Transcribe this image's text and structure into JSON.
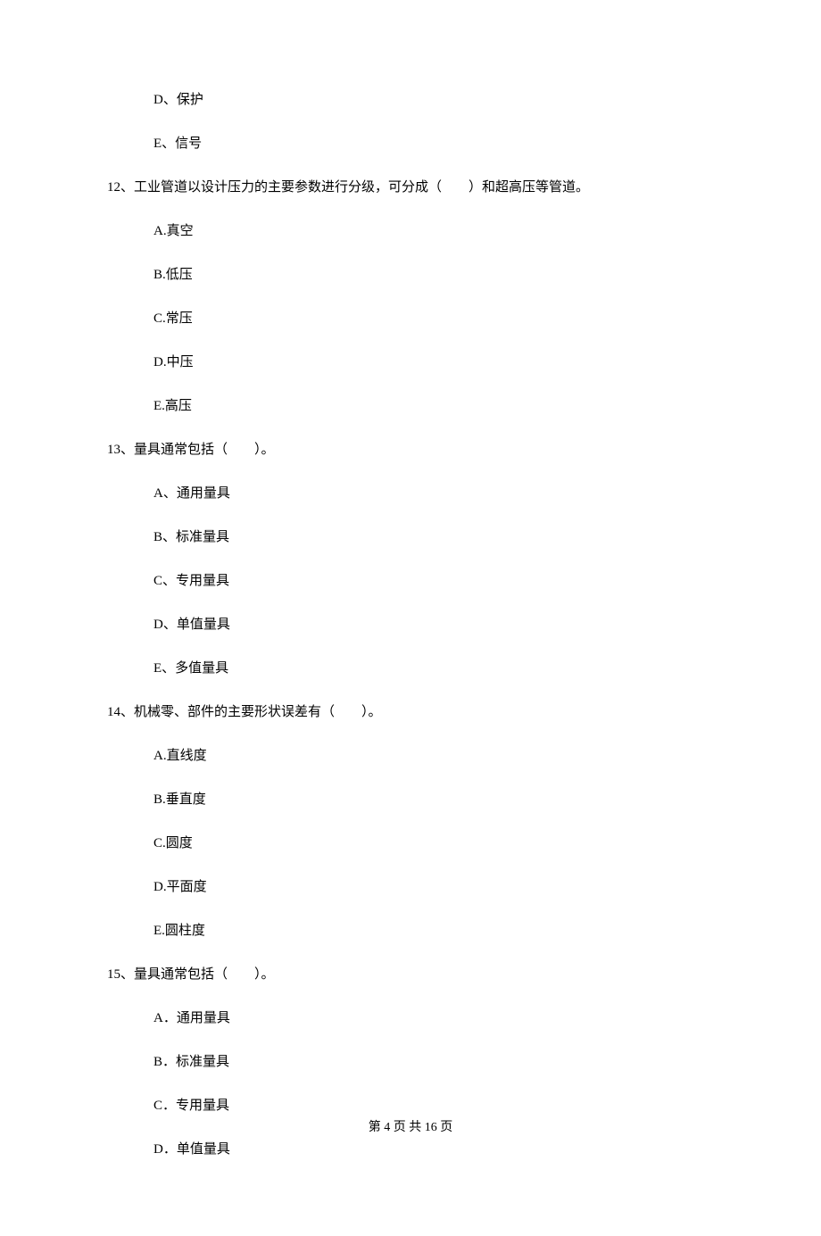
{
  "options_pre": [
    "D、保护",
    "E、信号"
  ],
  "q12": {
    "text": "12、工业管道以设计压力的主要参数进行分级，可分成（　　）和超高压等管道。",
    "opts": [
      "A.真空",
      "B.低压",
      "C.常压",
      "D.中压",
      "E.高压"
    ]
  },
  "q13": {
    "text": "13、量具通常包括（　　）。",
    "opts": [
      "A、通用量具",
      "B、标准量具",
      "C、专用量具",
      "D、单值量具",
      "E、多值量具"
    ]
  },
  "q14": {
    "text": "14、机械零、部件的主要形状误差有（　　）。",
    "opts": [
      "A.直线度",
      "B.垂直度",
      "C.圆度",
      "D.平面度",
      "E.圆柱度"
    ]
  },
  "q15": {
    "text": "15、量具通常包括（　　）。",
    "opts": [
      "A．通用量具",
      "B．标准量具",
      "C．专用量具",
      "D．单值量具"
    ]
  },
  "footer": "第 4 页 共 16 页"
}
